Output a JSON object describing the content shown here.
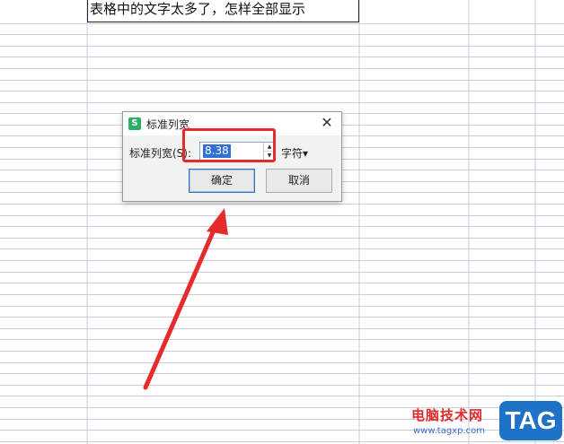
{
  "sheet": {
    "cell_text": "表格中的文字太多了，怎样全部显示"
  },
  "dialog": {
    "title": "标准列宽",
    "label": "标准列宽(S):",
    "value": "8.38",
    "unit": "字符",
    "ok_label": "确定",
    "cancel_label": "取消",
    "close_glyph": "✕",
    "app_icon_glyph": "S"
  },
  "icons": {
    "spin_up": "▲",
    "spin_down": "▼",
    "unit_caret": "▾"
  },
  "colors": {
    "highlight": "#e52b2b",
    "grid_line": "#c9cbe0",
    "selection": "#2f6fd6"
  },
  "watermark": {
    "cn": "电脑技术网",
    "url": "www.tagxp.com",
    "tag": "TAG"
  }
}
